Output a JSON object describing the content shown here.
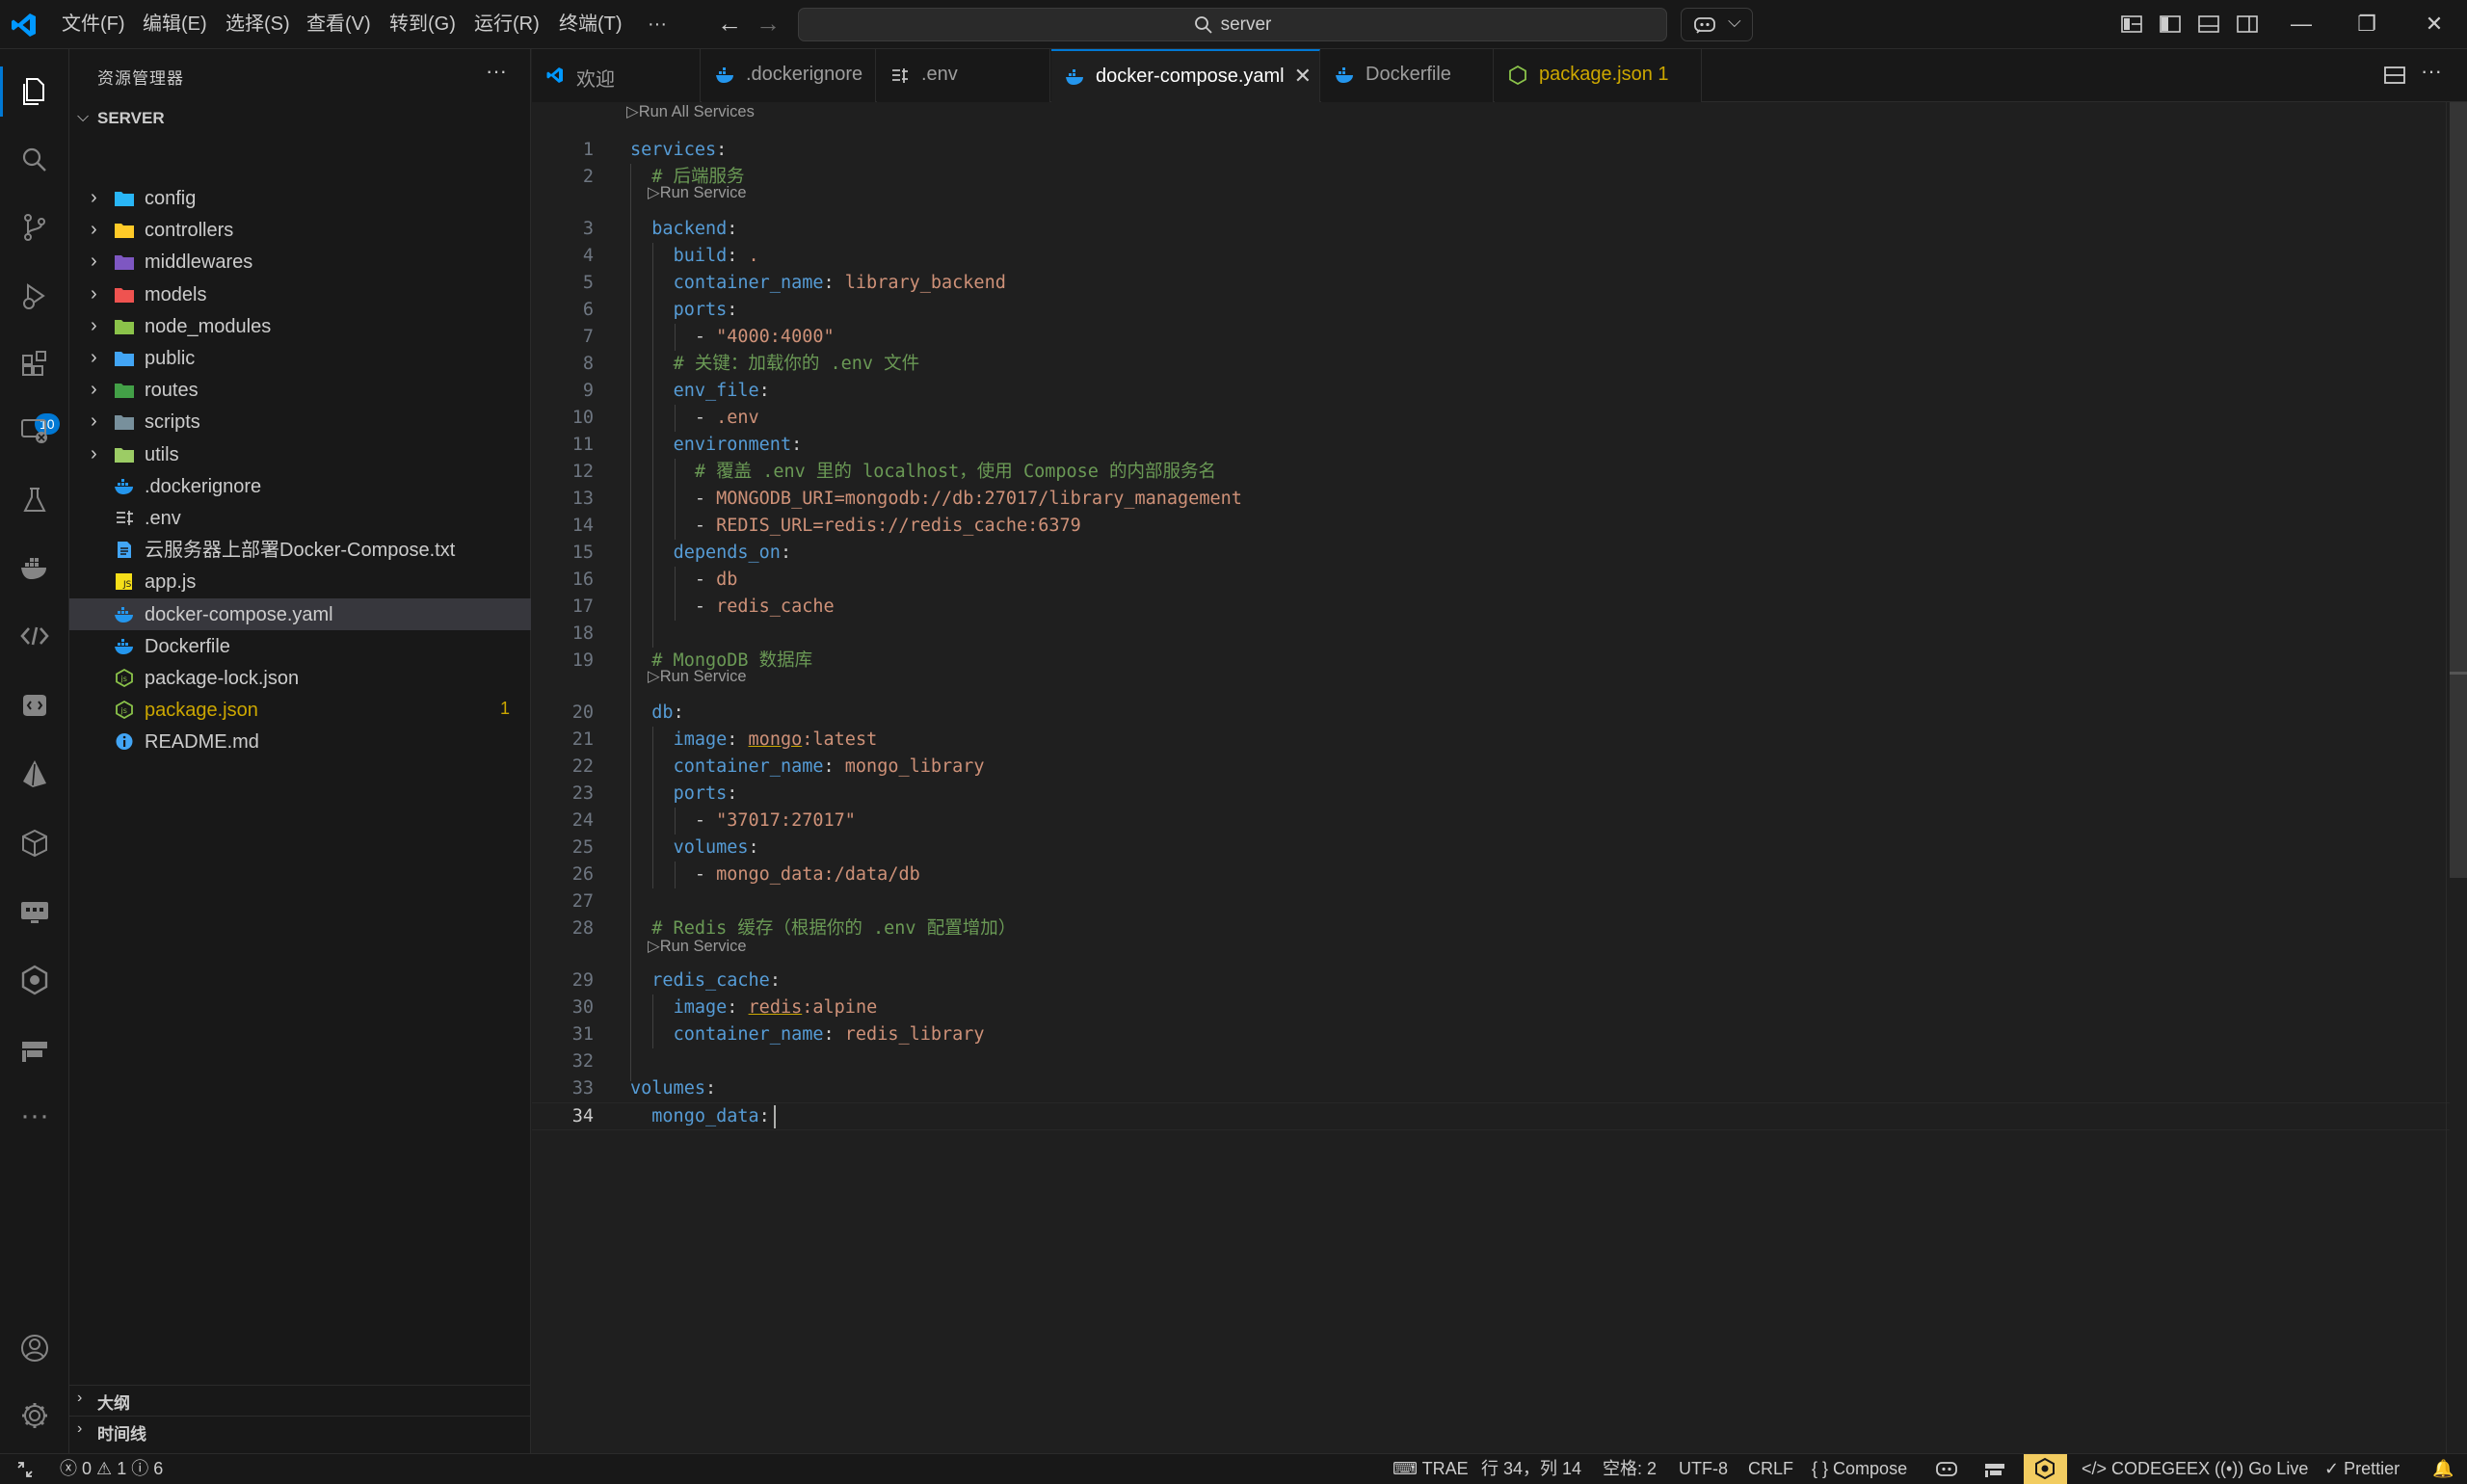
{
  "titlebar": {
    "menu": [
      "文件(F)",
      "编辑(E)",
      "选择(S)",
      "查看(V)",
      "转到(G)",
      "运行(R)",
      "终端(T)",
      "···"
    ],
    "search_text": "server",
    "icons": [
      "vscode-logo",
      "back-arrow",
      "forward-arrow",
      "search-icon",
      "copilot-icon",
      "chevron-down-icon",
      "customize-layout-icon",
      "toggle-sidebar-icon",
      "toggle-panel-icon",
      "toggle-secondary-sidebar-icon",
      "minimize-icon",
      "restore-icon",
      "close-icon"
    ]
  },
  "activitybar": {
    "items": [
      "explorer-icon",
      "search-icon",
      "source-control-icon",
      "run-debug-icon",
      "extensions-icon",
      "remote-explorer-icon",
      "testing-icon",
      "docker-icon",
      "codegeex-icon",
      "api-icon",
      "prisma-icon",
      "package-icon",
      "preview-icon",
      "gitkraken-icon",
      "fragment-icon",
      "more-icon"
    ],
    "extensions_badge": "10",
    "bottom": [
      "accounts-icon",
      "settings-icon"
    ]
  },
  "sidebar": {
    "title": "资源管理器",
    "more": "···",
    "section": "SERVER",
    "items": [
      {
        "name": "config",
        "kind": "folder",
        "color": "#29b6f6"
      },
      {
        "name": "controllers",
        "kind": "folder",
        "color": "#ffca28"
      },
      {
        "name": "middlewares",
        "kind": "folder",
        "color": "#7e57c2"
      },
      {
        "name": "models",
        "kind": "folder",
        "color": "#ef5350"
      },
      {
        "name": "node_modules",
        "kind": "folder",
        "color": "#8bc34a"
      },
      {
        "name": "public",
        "kind": "folder",
        "color": "#42a5f5"
      },
      {
        "name": "routes",
        "kind": "folder",
        "color": "#43a047"
      },
      {
        "name": "scripts",
        "kind": "folder",
        "color": "#78909c"
      },
      {
        "name": "utils",
        "kind": "folder",
        "color": "#9ccc65"
      },
      {
        "name": ".dockerignore",
        "kind": "docker"
      },
      {
        "name": ".env",
        "kind": "env"
      },
      {
        "name": "云服务器上部署Docker-Compose.txt",
        "kind": "txt"
      },
      {
        "name": "app.js",
        "kind": "js"
      },
      {
        "name": "docker-compose.yaml",
        "kind": "docker",
        "selected": true
      },
      {
        "name": "Dockerfile",
        "kind": "docker"
      },
      {
        "name": "package-lock.json",
        "kind": "nodejs"
      },
      {
        "name": "package.json",
        "kind": "nodejs",
        "modified": true,
        "badge": "1"
      },
      {
        "name": "README.md",
        "kind": "info"
      }
    ],
    "outline": "大纲",
    "timeline": "时间线"
  },
  "tabs": [
    {
      "label": "欢迎",
      "icon": "vscode-icon"
    },
    {
      "label": ".dockerignore",
      "icon": "docker-icon"
    },
    {
      "label": ".env",
      "icon": "env-icon"
    },
    {
      "label": "docker-compose.yaml",
      "icon": "docker-icon",
      "active": true,
      "close": "✕"
    },
    {
      "label": "Dockerfile",
      "icon": "docker-icon"
    },
    {
      "label": "package.json 1",
      "icon": "nodejs-icon",
      "modified": true
    }
  ],
  "editor": {
    "codelens": {
      "run_all": "Run All Services",
      "run_service": "Run Service"
    },
    "lines": [
      [
        [
          "k",
          "services"
        ],
        [
          "p",
          ":"
        ]
      ],
      [
        [
          "p",
          "  "
        ],
        [
          "c",
          "# 后端服务"
        ]
      ],
      [
        [
          "p",
          "  "
        ],
        [
          "k",
          "backend"
        ],
        [
          "p",
          ":"
        ]
      ],
      [
        [
          "p",
          "    "
        ],
        [
          "k",
          "build"
        ],
        [
          "p",
          ": "
        ],
        [
          "s",
          "."
        ]
      ],
      [
        [
          "p",
          "    "
        ],
        [
          "k",
          "container_name"
        ],
        [
          "p",
          ": "
        ],
        [
          "s",
          "library_backend"
        ]
      ],
      [
        [
          "p",
          "    "
        ],
        [
          "k",
          "ports"
        ],
        [
          "p",
          ":"
        ]
      ],
      [
        [
          "p",
          "      - "
        ],
        [
          "s",
          "\"4000:4000\""
        ]
      ],
      [
        [
          "p",
          "    "
        ],
        [
          "c",
          "# 关键：加载你的 .env 文件"
        ]
      ],
      [
        [
          "p",
          "    "
        ],
        [
          "k",
          "env_file"
        ],
        [
          "p",
          ":"
        ]
      ],
      [
        [
          "p",
          "      - "
        ],
        [
          "s",
          ".env"
        ]
      ],
      [
        [
          "p",
          "    "
        ],
        [
          "k",
          "environment"
        ],
        [
          "p",
          ":"
        ]
      ],
      [
        [
          "p",
          "      "
        ],
        [
          "c",
          "# 覆盖 .env 里的 localhost，使用 Compose 的内部服务名"
        ]
      ],
      [
        [
          "p",
          "      - "
        ],
        [
          "s",
          "MONGODB_URI=mongodb://db:27017/library_management"
        ]
      ],
      [
        [
          "p",
          "      - "
        ],
        [
          "s",
          "REDIS_URL=redis://redis_cache:6379"
        ]
      ],
      [
        [
          "p",
          "    "
        ],
        [
          "k",
          "depends_on"
        ],
        [
          "p",
          ":"
        ]
      ],
      [
        [
          "p",
          "      - "
        ],
        [
          "s",
          "db"
        ]
      ],
      [
        [
          "p",
          "      - "
        ],
        [
          "s",
          "redis_cache"
        ]
      ],
      [],
      [
        [
          "p",
          "  "
        ],
        [
          "c",
          "# MongoDB 数据库"
        ]
      ],
      [
        [
          "p",
          "  "
        ],
        [
          "k",
          "db"
        ],
        [
          "p",
          ":"
        ]
      ],
      [
        [
          "p",
          "    "
        ],
        [
          "k",
          "image"
        ],
        [
          "p",
          ": "
        ],
        [
          "su",
          "mongo"
        ],
        [
          "s",
          ":latest"
        ]
      ],
      [
        [
          "p",
          "    "
        ],
        [
          "k",
          "container_name"
        ],
        [
          "p",
          ": "
        ],
        [
          "s",
          "mongo_library"
        ]
      ],
      [
        [
          "p",
          "    "
        ],
        [
          "k",
          "ports"
        ],
        [
          "p",
          ":"
        ]
      ],
      [
        [
          "p",
          "      - "
        ],
        [
          "s",
          "\"37017:27017\""
        ]
      ],
      [
        [
          "p",
          "    "
        ],
        [
          "k",
          "volumes"
        ],
        [
          "p",
          ":"
        ]
      ],
      [
        [
          "p",
          "      - "
        ],
        [
          "s",
          "mongo_data:/data/db"
        ]
      ],
      [],
      [
        [
          "p",
          "  "
        ],
        [
          "c",
          "# Redis 缓存（根据你的 .env 配置增加）"
        ]
      ],
      [
        [
          "p",
          "  "
        ],
        [
          "k",
          "redis_cache"
        ],
        [
          "p",
          ":"
        ]
      ],
      [
        [
          "p",
          "    "
        ],
        [
          "k",
          "image"
        ],
        [
          "p",
          ": "
        ],
        [
          "su",
          "redis"
        ],
        [
          "s",
          ":alpine"
        ]
      ],
      [
        [
          "p",
          "    "
        ],
        [
          "k",
          "container_name"
        ],
        [
          "p",
          ": "
        ],
        [
          "s",
          "redis_library"
        ]
      ],
      [],
      [
        [
          "k",
          "volumes"
        ],
        [
          "p",
          ":"
        ]
      ],
      [
        [
          "p",
          "  "
        ],
        [
          "k",
          "mongo_data"
        ],
        [
          "p",
          ":"
        ]
      ]
    ],
    "current_line": 34
  },
  "statusbar": {
    "left": {
      "errors": "0",
      "warnings": "1",
      "infos": "6"
    },
    "right": [
      "TRAE",
      "行 34，列 14",
      "空格: 2",
      "UTF-8",
      "CRLF",
      "Compose",
      "CODEGEEX",
      "Go Live",
      "Prettier"
    ],
    "colors": {
      "highlight": "#f2cc60",
      "accent": "#0078d4"
    }
  }
}
